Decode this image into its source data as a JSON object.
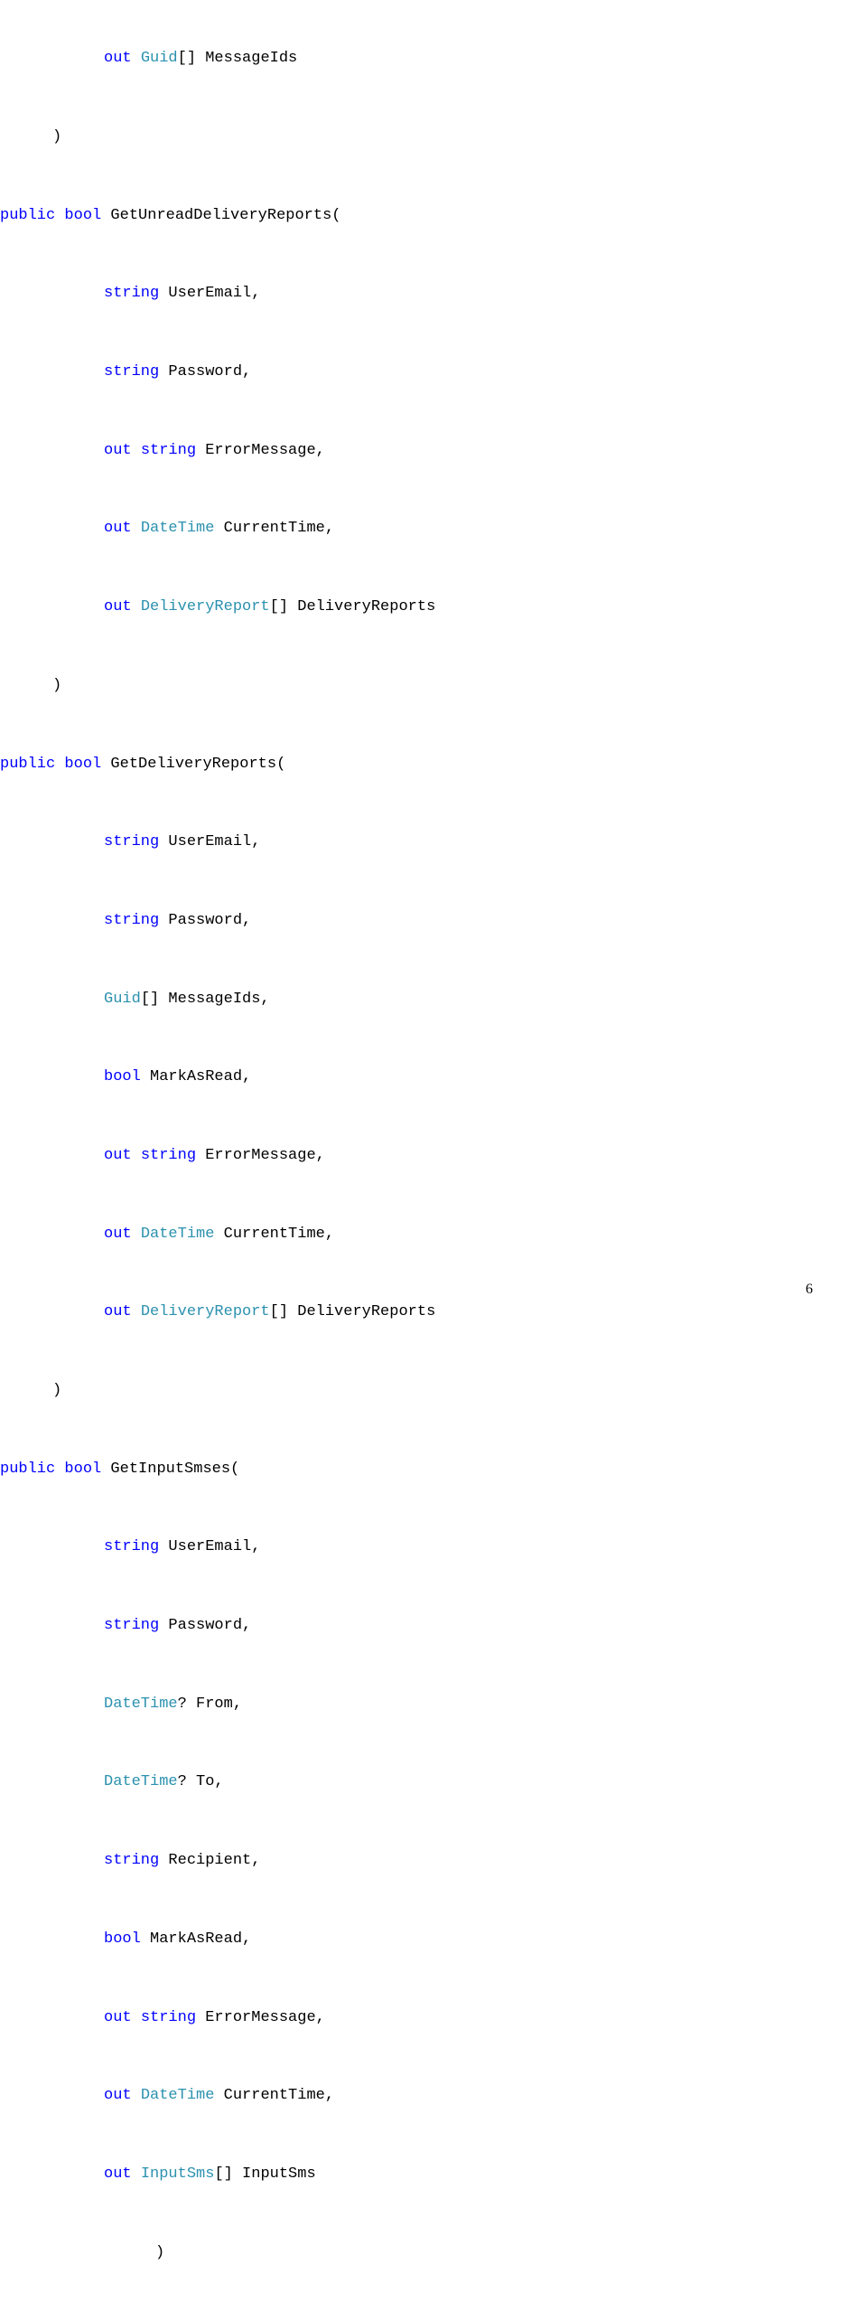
{
  "lines": {
    "l1_out": "out",
    "l1_type": "Guid",
    "l1_rest": "[] MessageIds",
    "l2_paren": ")",
    "l3_pub": "public",
    "l3_bool": "bool",
    "l3_name": " GetUnreadDeliveryReports(",
    "l4_kw": "string",
    "l4_rest": " UserEmail,",
    "l5_kw": "string",
    "l5_rest": " Password,",
    "l6_out": "out",
    "l6_kw": "string",
    "l6_rest": " ErrorMessage,",
    "l7_out": "out",
    "l7_type": "DateTime",
    "l7_rest": " CurrentTime,",
    "l8_out": "out",
    "l8_type": "DeliveryReport",
    "l8_rest": "[] DeliveryReports",
    "l9_paren": ")",
    "l10_pub": "public",
    "l10_bool": "bool",
    "l10_name": " GetDeliveryReports(",
    "l11_kw": "string",
    "l11_rest": " UserEmail,",
    "l12_kw": "string",
    "l12_rest": " Password,",
    "l13_type": "Guid",
    "l13_rest": "[] MessageIds,",
    "l14_kw": "bool",
    "l14_rest": " MarkAsRead,",
    "l15_out": "out",
    "l15_kw": "string",
    "l15_rest": " ErrorMessage,",
    "l16_out": "out",
    "l16_type": "DateTime",
    "l16_rest": " CurrentTime,",
    "l17_out": "out",
    "l17_type": "DeliveryReport",
    "l17_rest": "[] DeliveryReports",
    "l18_paren": ")",
    "l19_pub": "public",
    "l19_bool": "bool",
    "l19_name": " GetInputSmses(",
    "l20_kw": "string",
    "l20_rest": " UserEmail,",
    "l21_kw": "string",
    "l21_rest": " Password,",
    "l22_type": "DateTime",
    "l22_rest": "? From,",
    "l23_type": "DateTime",
    "l23_rest": "? To,",
    "l24_kw": "string",
    "l24_rest": " Recipient,",
    "l25_kw": "bool",
    "l25_rest": " MarkAsRead,",
    "l26_out": "out",
    "l26_kw": "string",
    "l26_rest": " ErrorMessage,",
    "l27_out": "out",
    "l27_type": "DateTime",
    "l27_rest": " CurrentTime,",
    "l28_out": "out",
    "l28_type": "InputSms",
    "l28_rest": "[] InputSms",
    "l29_paren": ")"
  },
  "page_number": "6"
}
